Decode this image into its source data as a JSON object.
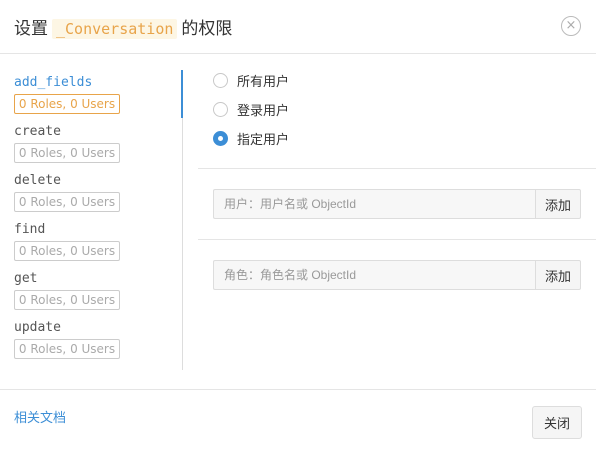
{
  "dialog": {
    "title_prefix": "设置",
    "class_name": "_Conversation",
    "title_suffix": "的权限",
    "close_glyph": "×"
  },
  "operations": [
    {
      "name": "add_fields",
      "badge": "0 Roles, 0 Users",
      "active": true
    },
    {
      "name": "create",
      "badge": "0 Roles, 0 Users",
      "active": false
    },
    {
      "name": "delete",
      "badge": "0 Roles, 0 Users",
      "active": false
    },
    {
      "name": "find",
      "badge": "0 Roles, 0 Users",
      "active": false
    },
    {
      "name": "get",
      "badge": "0 Roles, 0 Users",
      "active": false
    },
    {
      "name": "update",
      "badge": "0 Roles, 0 Users",
      "active": false
    }
  ],
  "access": {
    "options": [
      "所有用户",
      "登录用户",
      "指定用户"
    ],
    "selected_index": 2
  },
  "user_field": {
    "placeholder": "用户：用户名或 ObjectId",
    "value": "",
    "add_label": "添加"
  },
  "role_field": {
    "placeholder": "角色：角色名或 ObjectId",
    "value": "",
    "add_label": "添加"
  },
  "footer": {
    "doc_link": "相关文档",
    "close_label": "关闭"
  },
  "colors": {
    "accent": "#3c8ed6",
    "badge_active": "#e8a44a"
  }
}
